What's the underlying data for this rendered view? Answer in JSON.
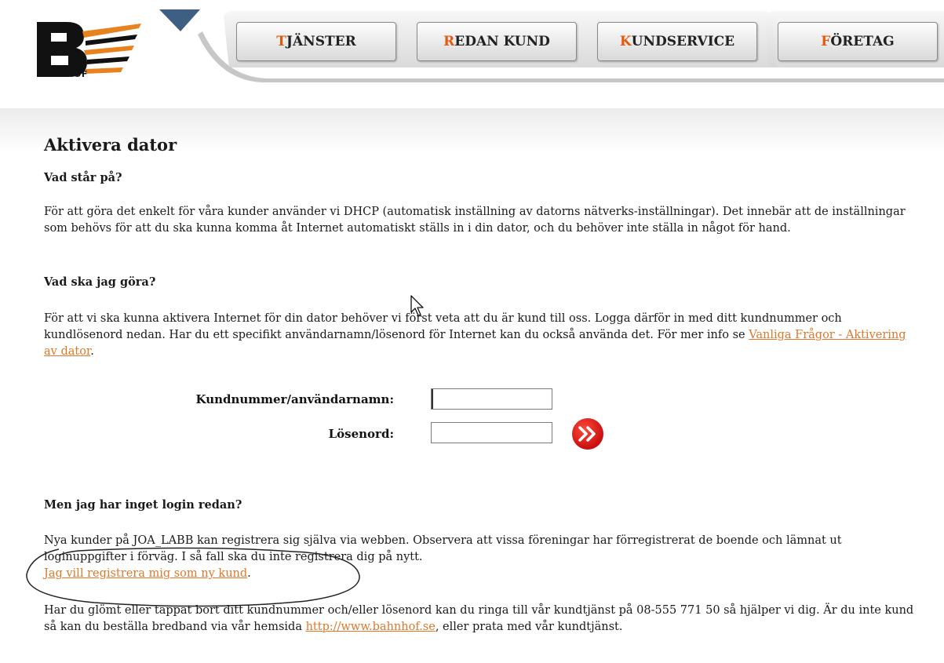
{
  "logo": {
    "text": "BAHNHOF"
  },
  "nav": {
    "tabs": [
      {
        "first": "T",
        "rest": "JÄNSTER"
      },
      {
        "first": "R",
        "rest": "EDAN KUND"
      },
      {
        "first": "K",
        "rest": "UNDSERVICE"
      },
      {
        "first": "F",
        "rest": "ÖRETAG"
      }
    ],
    "accent_color": "#e05b10"
  },
  "page": {
    "title": "Aktivera dator",
    "section1": {
      "heading": "Vad står på?",
      "text": "För att göra det enkelt för våra kunder använder vi DHCP (automatisk inställning av datorns nätverks-inställningar). Det innebär att de inställningar som behövs för att du ska kunna komma åt Internet automatiskt ställs in i din dator, och du behöver inte ställa in något för hand."
    },
    "section2": {
      "heading": "Vad ska jag göra?",
      "text_before_link": "För att vi ska kunna aktivera Internet för din dator behöver vi först veta att du är kund till oss. Logga därför in med ditt kundnummer och kundlösenord nedan. Har du ett specifikt användarnamn/lösenord för Internet kan du också använda det. För mer info se ",
      "link": "Vanliga Frågor - Aktivering av dator",
      "text_after_link": "."
    },
    "login": {
      "username_label": "Kundnummer/användarnamn:",
      "username_value": "",
      "password_label": "Lösenord:",
      "password_value": "",
      "submit_icon": "double-chevron-right-icon"
    },
    "section3": {
      "heading": "Men jag har inget login redan?",
      "text": "Nya kunder på JOA_LABB kan registrera sig själva via webben. Observera att vissa föreningar har förregistrerat de boende och lämnat ut loginuppgifter i förväg. I så fall ska du inte registrera dig på nytt.",
      "register_link": "Jag vill registrera mig som ny kund",
      "register_after": "."
    },
    "section4": {
      "text_before_link": "Har du glömt eller tappat bort ditt kundnummer och/eller lösenord kan du ringa till vår kundtjänst på 08-555 771 50 så hjälper vi dig. Är du inte kund så kan du beställa bredband via vår hemsida ",
      "link": "http://www.bahnhof.se",
      "text_after_link": ", eller prata med vår kundtjänst."
    },
    "link_color": "#e0782a"
  }
}
